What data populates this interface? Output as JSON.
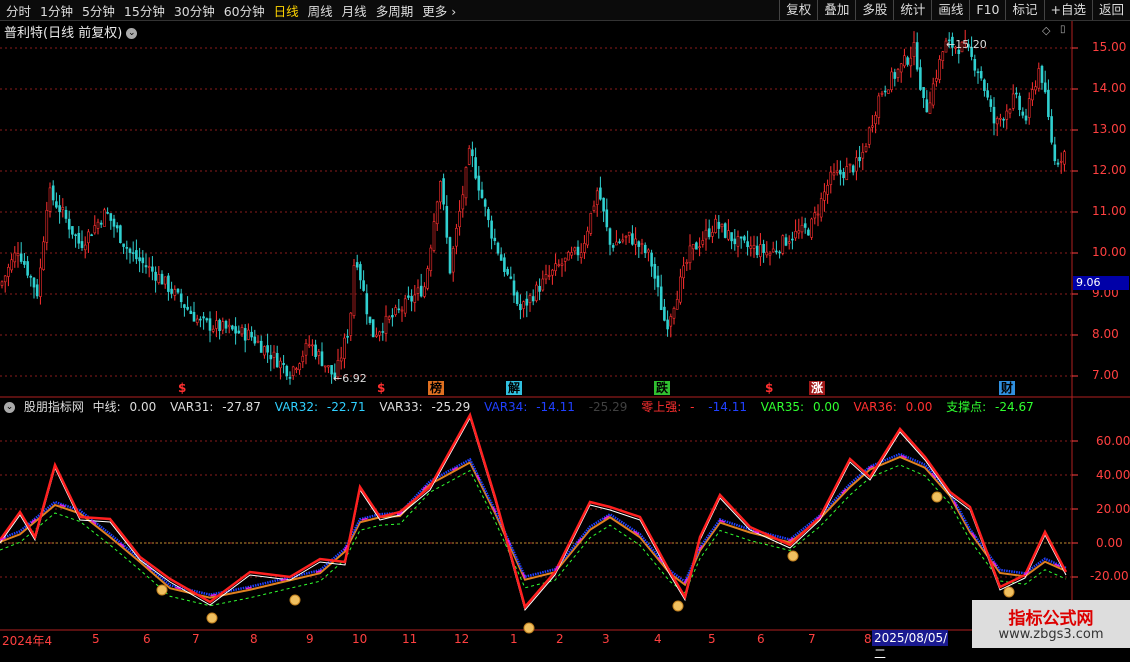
{
  "toolbar": {
    "periods": [
      "分时",
      "1分钟",
      "5分钟",
      "15分钟",
      "30分钟",
      "60分钟",
      "日线",
      "周线",
      "月线",
      "多周期",
      "更多"
    ],
    "active_period": "日线",
    "buttons": [
      "复权",
      "叠加",
      "多股",
      "统计",
      "画线",
      "F10",
      "标记",
      "+自选",
      "返回"
    ]
  },
  "stock": {
    "title": "普利特(日线 前复权)"
  },
  "price_axis": [
    "15.00",
    "14.00",
    "13.00",
    "12.00",
    "11.00",
    "10.00",
    "9.00",
    "8.00",
    "7.00"
  ],
  "price_tag": "9.06",
  "annotations": {
    "high": "15.20",
    "low": "6.92"
  },
  "events": [
    {
      "label": "$",
      "color": "#ff3030",
      "bg": "none"
    },
    {
      "label": "$",
      "color": "#ff3030",
      "bg": "none"
    },
    {
      "label": "榜",
      "color": "#000",
      "bg": "#e07020"
    },
    {
      "label": "解",
      "color": "#000",
      "bg": "#30c0e0"
    },
    {
      "label": "跌",
      "color": "#000",
      "bg": "#30c030"
    },
    {
      "label": "$",
      "color": "#ff3030",
      "bg": "none"
    },
    {
      "label": "涨",
      "color": "#fff",
      "bg": "#a01818"
    },
    {
      "label": "财",
      "color": "#000",
      "bg": "#3090e0"
    }
  ],
  "indicator": {
    "name": "股朋指标网",
    "items": [
      {
        "label": "中线:",
        "value": "0.00",
        "color": "#dddddd"
      },
      {
        "label": "VAR31:",
        "value": "-27.87",
        "color": "#dddddd"
      },
      {
        "label": "VAR32:",
        "value": "-22.71",
        "color": "#30d0ff"
      },
      {
        "label": "VAR33:",
        "value": "-25.29",
        "color": "#dddddd"
      },
      {
        "label": "VAR34:",
        "value": "-14.11",
        "color": "#2040ff"
      },
      {
        "label": "",
        "value": "-25.29",
        "color": "#404040"
      },
      {
        "label": "零上强:",
        "value": "-",
        "color": "#ff3030"
      },
      {
        "label": "",
        "value": "-14.11",
        "color": "#2040ff"
      },
      {
        "label": "VAR35:",
        "value": "0.00",
        "color": "#30ff30"
      },
      {
        "label": "VAR36:",
        "value": "0.00",
        "color": "#ff3030"
      },
      {
        "label": "支撑点:",
        "value": "-24.67",
        "color": "#30ff30"
      }
    ]
  },
  "indicator_axis": [
    "60.00",
    "40.00",
    "20.00",
    "0.00",
    "-20.00"
  ],
  "date_axis": [
    "2024年4",
    "5",
    "6",
    "7",
    "8",
    "9",
    "10",
    "11",
    "12",
    "1",
    "2",
    "3",
    "4",
    "5",
    "6",
    "7",
    "8"
  ],
  "date_highlight": "2025/08/05/二",
  "watermark": {
    "line1": "指标公式网",
    "line2": "www.zbgs3.com"
  },
  "icons": [
    "chevron-down-icon",
    "diamond-icon",
    "settings-icon",
    "finger-icon"
  ],
  "colors": {
    "up": "#ff3030",
    "down": "#30d0d0",
    "grid": "#8a1c1c",
    "axis": "#ff4040",
    "bg": "#000000"
  }
}
